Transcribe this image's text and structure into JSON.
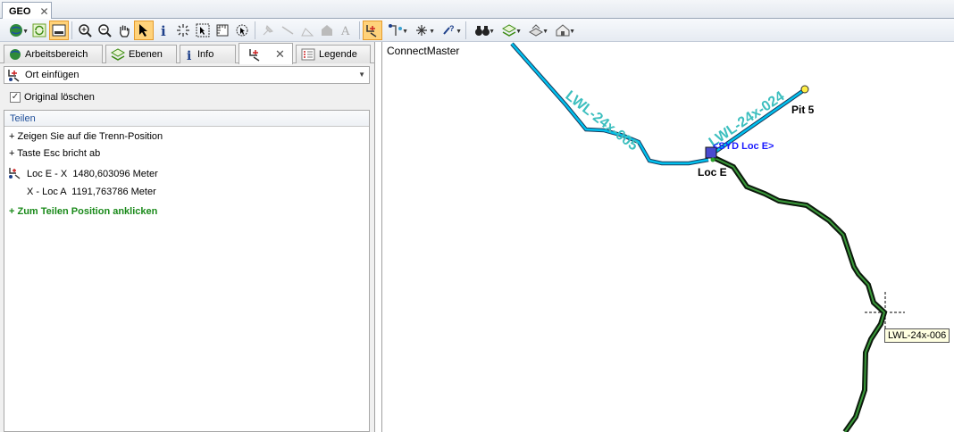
{
  "doc_tab": {
    "label": "GEO",
    "close": "✕"
  },
  "panel": {
    "tabs": [
      {
        "label": "Arbeitsbereich",
        "icon": "globe-icon"
      },
      {
        "label": "Ebenen",
        "icon": "layers-icon"
      },
      {
        "label": "Info",
        "icon": "info-icon"
      },
      {
        "label": "",
        "icon": "split-tool-icon",
        "close": "✕"
      },
      {
        "label": "Legende",
        "icon": "legend-icon"
      }
    ],
    "combo_value": "Ort einfügen",
    "original_loeschen": {
      "label": "Original löschen",
      "checked": true
    },
    "section_title": "Teilen",
    "instructions": [
      "+ Zeigen Sie auf die Trenn-Position",
      "+ Taste Esc bricht ab"
    ],
    "measures": [
      {
        "text": "Loc E - X  1480,603096 Meter"
      },
      {
        "text": "X - Loc A  1191,763786 Meter"
      }
    ],
    "action_hint": "+ Zum Teilen Position anklicken"
  },
  "map": {
    "title": "ConnectMaster",
    "cable_labels": [
      "LWL-24x-005",
      "LWL-24x-024"
    ],
    "node_labels": [
      "Pit 5",
      "Loc E"
    ],
    "site_label": "<SYD Loc E>",
    "tooltip": "LWL-24x-006",
    "colors": {
      "cable_cyan": "#00b4e6",
      "cable_label": "#3dbfbf",
      "cable_green_outline": "#1e7a1e",
      "site_label": "#1a1aff"
    }
  }
}
